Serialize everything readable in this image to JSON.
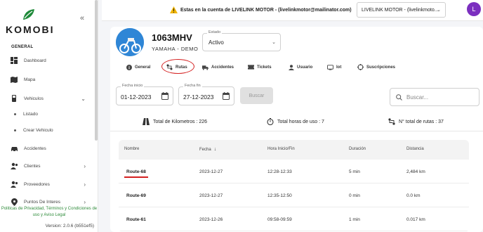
{
  "sidebar": {
    "brand": "KOMOBI",
    "section": "GENERAL",
    "items": [
      {
        "label": "Dashboard"
      },
      {
        "label": "Mapa"
      },
      {
        "label": "Vehiculos"
      },
      {
        "label": "Listado"
      },
      {
        "label": "Crear Vehiculo"
      },
      {
        "label": "Accidentes"
      },
      {
        "label": "Clientes"
      },
      {
        "label": "Proveedores"
      },
      {
        "label": "Puntos De Interes"
      }
    ],
    "policy": "Politicas de Privacidad, Términos y Condiciones de uso y Aviso Legal",
    "version": "Version: 2.0.6 (b551ef5)"
  },
  "topbar": {
    "warning": "Estas en la cuenta de LIVELINK MOTOR - (livelinkmotor@mailinator.com)",
    "account": "LIVELINK MOTOR - (livelinkmoto...",
    "avatar": "L"
  },
  "vehicle": {
    "plate": "1063MHV",
    "model": "YAMAHA - DEMO",
    "estado_label": "Estado",
    "estado_value": "Activo"
  },
  "tabs": [
    {
      "label": "General"
    },
    {
      "label": "Rutas"
    },
    {
      "label": "Accidentes"
    },
    {
      "label": "Tickets"
    },
    {
      "label": "Usuario"
    },
    {
      "label": "Iot"
    },
    {
      "label": "Suscripciones"
    }
  ],
  "filters": {
    "inicio_label": "Fecha inicio",
    "inicio_value": "01-12-2023",
    "fin_label": "Fecha fin",
    "fin_value": "27-12-2023",
    "buscar": "Buscar",
    "search_placeholder": "Buscar..."
  },
  "stats": {
    "km": "Total de Kilometros : 226",
    "horas": "Total horas de uso : 7",
    "rutas": "N° total de rutas : 37"
  },
  "table": {
    "headers": [
      "Nombre",
      "Fecha",
      "Hora Inicio/Fin",
      "Duración",
      "Distancia"
    ],
    "rows": [
      [
        "Route-68",
        "2023-12-27",
        "12:28-12:33",
        "5 min",
        "2,484 km"
      ],
      [
        "Route-69",
        "2023-12-27",
        "12:35-12:50",
        "0 min",
        "0.0 km"
      ],
      [
        "Route-61",
        "2023-12-26",
        "09:58-09:59",
        "1 min",
        "0.017 km"
      ]
    ]
  },
  "colors": {
    "accent": "#2e8b3a",
    "highlight": "#d42020",
    "avatar": "#7b2fbf"
  }
}
